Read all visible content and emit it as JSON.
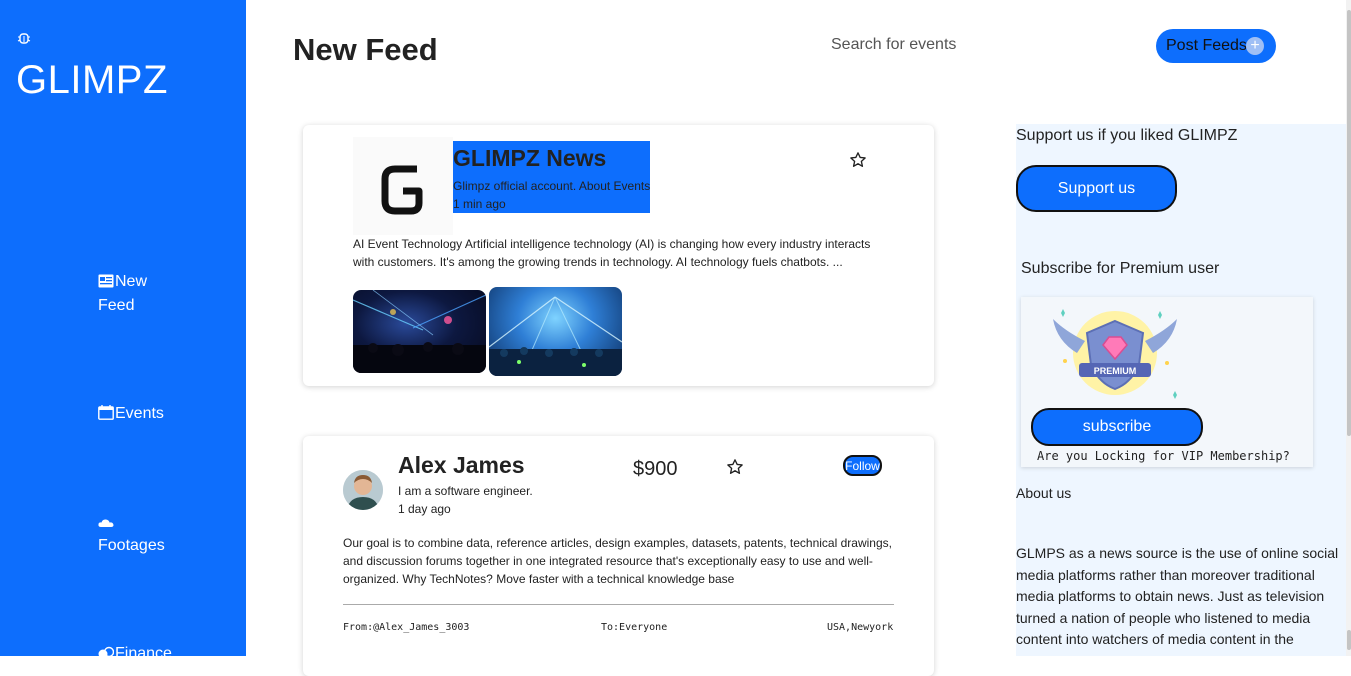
{
  "sidebar": {
    "brand": "GLIMPZ",
    "items": [
      {
        "label": "New Feed",
        "icon": "newspaper-icon"
      },
      {
        "label": "Events",
        "icon": "calendar-icon"
      },
      {
        "label": "Footages",
        "icon": "cloud-icon"
      },
      {
        "label": "Finance",
        "icon": "coins-icon"
      }
    ]
  },
  "header": {
    "title": "New Feed",
    "search_placeholder": "Search for events",
    "post_button": "Post Feeds",
    "post_icon": "+"
  },
  "feed": [
    {
      "title": "GLIMPZ News",
      "subtitle": "Glimpz official account. About Events",
      "time": "1 min ago",
      "body": "AI Event Technology Artificial intelligence technology (AI) is changing how every industry interacts with customers. It's among the growing trends in technology. AI technology fuels chatbots. ..."
    },
    {
      "author": "Alex James",
      "bio": "I am a software engineer.",
      "time": "1 day ago",
      "price": "$900",
      "follow": "Follow",
      "body": "Our goal is to combine data, reference articles, design examples, datasets, patents, technical drawings, and discussion forums together in one integrated resource that's exceptionally easy to use and well-organized. Why TechNotes? Move faster with a technical knowledge base",
      "from": "From:@Alex_James_3003",
      "to": "To:Everyone",
      "location": "USA,Newyork"
    }
  ],
  "right": {
    "support_text": "Support us if you liked GLIMPZ",
    "support_button": "Support us",
    "premium_text": "Subscribe for Premium user",
    "badge_label": "PREMIUM",
    "subscribe_button": "subscribe",
    "vip_text": "Are you Locking for VIP Membership?",
    "about_title": "About us",
    "about_body": "GLMPS as a news source is the use of online social media platforms rather than moreover traditional media platforms to obtain news. Just as television turned a nation of people who listened to media content into watchers of media content in the"
  },
  "colors": {
    "primary": "#0d6efd",
    "panel": "#eef6ff"
  }
}
